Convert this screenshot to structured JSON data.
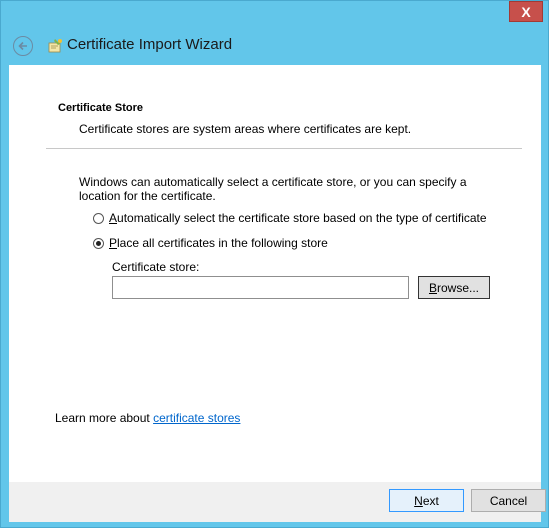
{
  "window": {
    "title": "Certificate Import Wizard",
    "close_glyph": "X",
    "icons": {
      "close": "close-icon",
      "back": "back-arrow-icon",
      "wizard": "certificate-wizard-icon"
    }
  },
  "section": {
    "title": "Certificate Store",
    "description": "Certificate stores are system areas where certificates are kept."
  },
  "intro": "Windows can automatically select a certificate store, or you can specify a location for the certificate.",
  "options": {
    "auto": {
      "accel": "A",
      "rest": "utomatically select the certificate store based on the type of certificate",
      "selected": false
    },
    "place": {
      "accel": "P",
      "rest": "lace all certificates in the following store",
      "selected": true
    }
  },
  "store": {
    "label": "Certificate store:",
    "value": ""
  },
  "browse": {
    "accel": "B",
    "rest": "rowse..."
  },
  "learn_more": {
    "prefix": "Learn more about ",
    "link": "certificate stores"
  },
  "footer": {
    "next": {
      "accel": "N",
      "rest": "ext"
    },
    "cancel": "Cancel"
  }
}
